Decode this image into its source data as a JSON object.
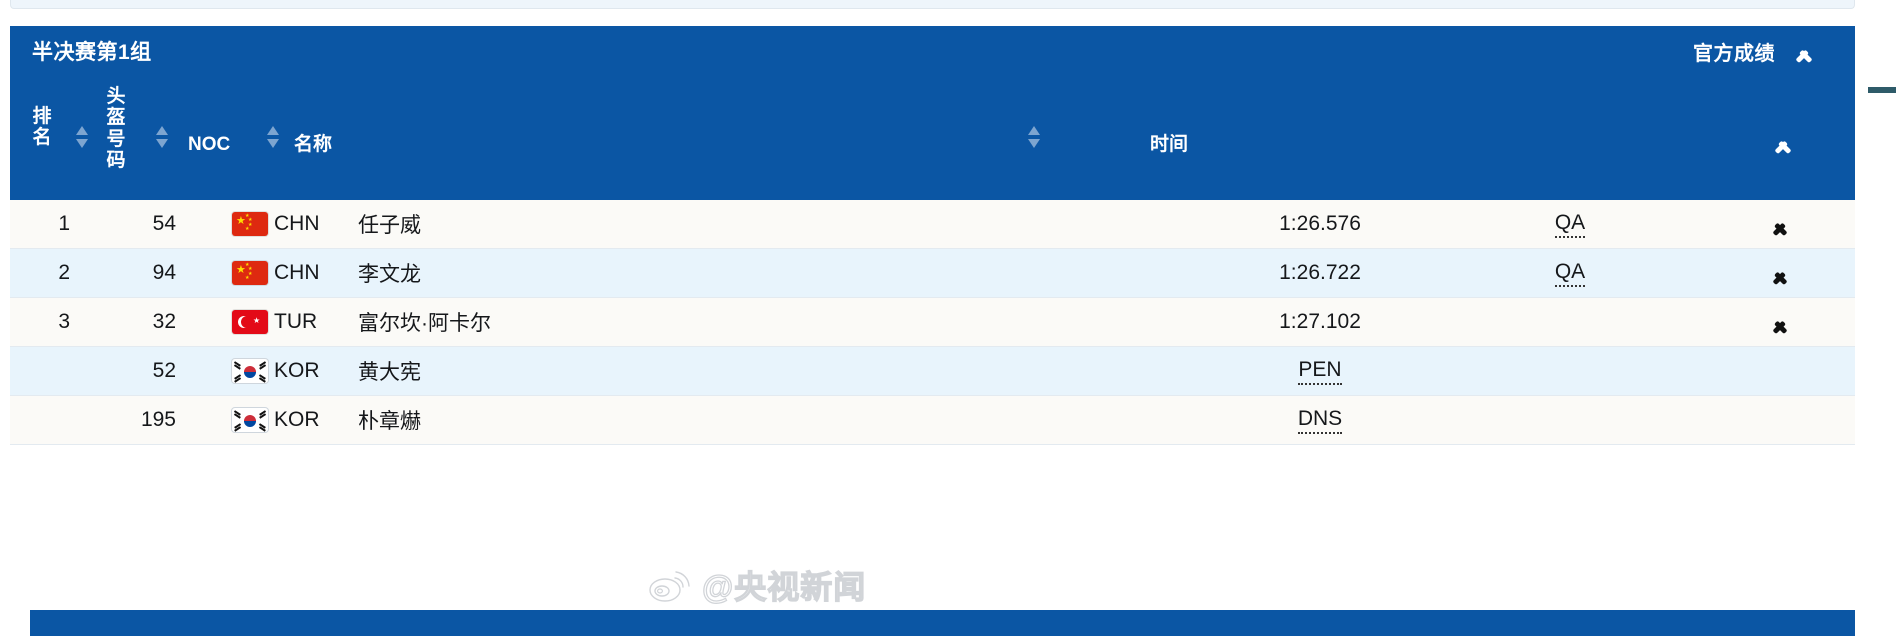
{
  "panel": {
    "title": "半决赛第1组",
    "official_results_label": "官方成绩",
    "collapse_icon": "chevron-up-icon"
  },
  "table": {
    "headers": {
      "rank": "排名",
      "helmet_number": "头盔号码",
      "noc": "NOC",
      "name": "名称",
      "time": "时间"
    },
    "sort_icon": "sort-updown-icon",
    "header_collapse_icon": "chevron-up-icon",
    "rows": [
      {
        "rank": "1",
        "helmet": "54",
        "flag": "chn",
        "noc": "CHN",
        "name": "任子威",
        "time": "1:26.576",
        "time_abbr": false,
        "qualification": "QA",
        "qualification_abbr": true,
        "has_chevron": true,
        "stripe": "odd"
      },
      {
        "rank": "2",
        "helmet": "94",
        "flag": "chn",
        "noc": "CHN",
        "name": "李文龙",
        "time": "1:26.722",
        "time_abbr": false,
        "qualification": "QA",
        "qualification_abbr": true,
        "has_chevron": true,
        "stripe": "even"
      },
      {
        "rank": "3",
        "helmet": "32",
        "flag": "tur",
        "noc": "TUR",
        "name": "富尔坎·阿卡尔",
        "time": "1:27.102",
        "time_abbr": false,
        "qualification": "",
        "qualification_abbr": false,
        "has_chevron": true,
        "stripe": "odd"
      },
      {
        "rank": "",
        "helmet": "52",
        "flag": "kor",
        "noc": "KOR",
        "name": "黄大宪",
        "time": "PEN",
        "time_abbr": true,
        "qualification": "",
        "qualification_abbr": false,
        "has_chevron": false,
        "stripe": "even"
      },
      {
        "rank": "",
        "helmet": "195",
        "flag": "kor",
        "noc": "KOR",
        "name": "朴章爀",
        "time": "DNS",
        "time_abbr": true,
        "qualification": "",
        "qualification_abbr": false,
        "has_chevron": false,
        "stripe": "odd"
      }
    ]
  },
  "watermark": {
    "icon": "weibo-logo-icon",
    "text": "@央视新闻"
  },
  "colors": {
    "header_blue": "#0b56a4",
    "row_odd": "#fbfaf7",
    "row_even": "#e8f4fc",
    "text_dark": "#15171a"
  }
}
